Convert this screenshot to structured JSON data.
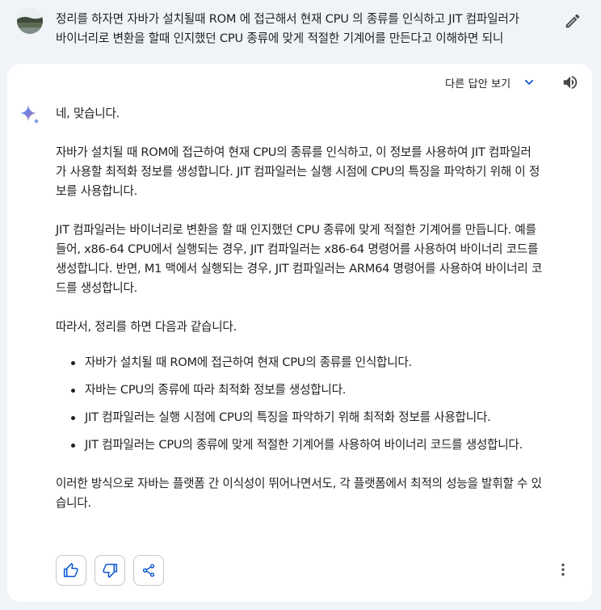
{
  "user": {
    "avatar": "avatar-landscape-image",
    "message_lines": [
      "정리를 하자면 자바가 설치될때 ROM 에 접근해서 현재 CPU 의 종류를 인식하고 JIT 컴파일러가",
      "바이너리로 변환을 할때 인지했던 CPU 종류에 맞게 적절한 기계어를 만든다고 이해하면 되니"
    ],
    "edit_icon": "pencil-icon"
  },
  "response": {
    "drafts_label": "다른 답안 보기",
    "drafts_icon": "chevron-down-icon",
    "speaker_icon": "volume-icon",
    "logo_icon": "sparkle-icon",
    "paragraph_1": [
      "네, 맞습니다."
    ],
    "paragraph_2": [
      "자바가 설치될 때 ROM에 접근하여 현재 CPU의 종류를 인식하고, 이 정보를 사용하여 JIT 컴파일러",
      "가 사용할 최적화 정보를 생성합니다. JIT 컴파일러는 실행 시점에 CPU의 특징을 파악하기 위해 이 정",
      "보를 사용합니다."
    ],
    "paragraph_3": [
      "JIT 컴파일러는 바이너리로 변환을 할 때 인지했던 CPU 종류에 맞게 적절한 기계어를 만듭니다. 예를",
      "들어, x86-64 CPU에서 실행되는 경우, JIT 컴파일러는 x86-64 명령어를 사용하여 바이너리 코드를",
      "생성합니다. 반면, M1 맥에서 실행되는 경우, JIT 컴파일러는 ARM64 명령어를 사용하여 바이너리 코",
      "드를 생성합니다."
    ],
    "paragraph_4": [
      "따라서, 정리를 하면 다음과 같습니다."
    ],
    "bullets": [
      "자바가 설치될 때 ROM에 접근하여 현재 CPU의 종류를 인식합니다.",
      "자바는 CPU의 종류에 따라 최적화 정보를 생성합니다.",
      "JIT 컴파일러는 실행 시점에 CPU의 특징을 파악하기 위해 최적화 정보를 사용합니다.",
      "JIT 컴파일러는 CPU의 종류에 맞게 적절한 기계어를 사용하여 바이너리 코드를 생성합니다."
    ],
    "paragraph_5": [
      "이러한 방식으로 자바는 플랫폼 간 이식성이 뛰어나면서도, 각 플랫폼에서 최적의 성능을 발휘할 수 있",
      "습니다."
    ]
  },
  "actions": {
    "thumbs_up_icon": "thumbs-up-icon",
    "thumbs_down_icon": "thumbs-down-icon",
    "share_icon": "share-icon",
    "more_icon": "more-vert-icon"
  },
  "colors": {
    "page_bg": "#f0f4f9",
    "card_bg": "#ffffff",
    "accent_blue": "#0b57d0",
    "text": "#1f1f1f"
  }
}
